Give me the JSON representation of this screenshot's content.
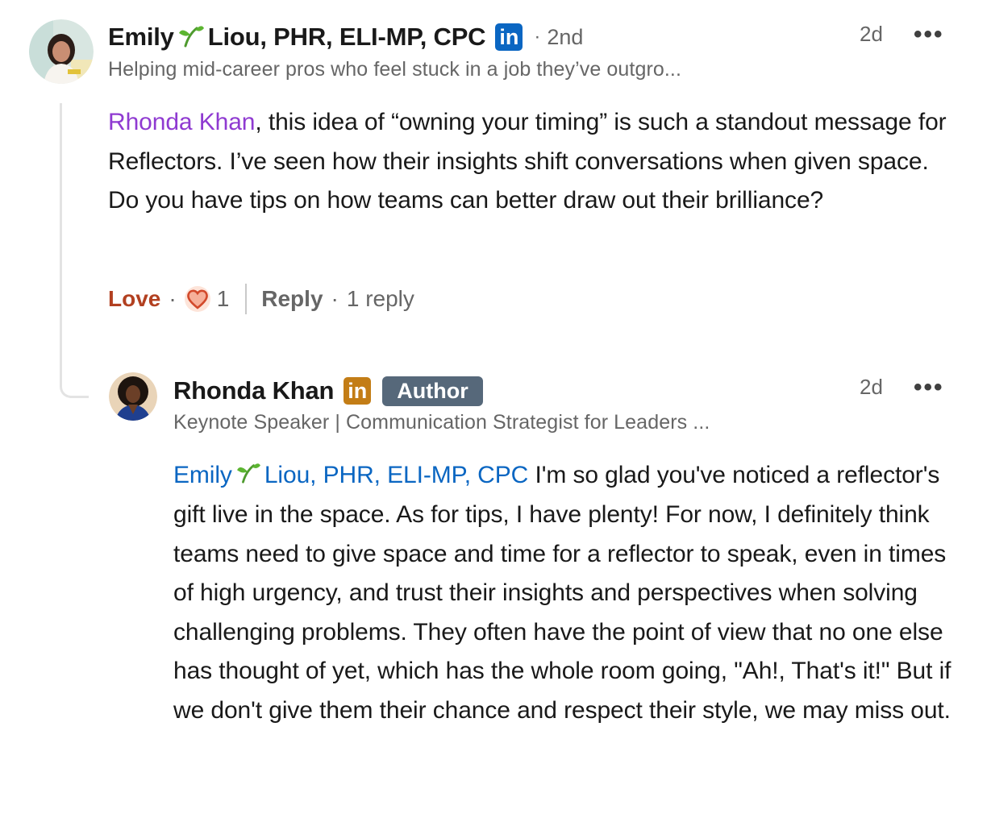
{
  "comment": {
    "author": {
      "first_name": "Emily",
      "emoji": "sprout",
      "rest_name": "Liou, PHR, ELI-MP, CPC",
      "linkedin_badge": "in",
      "degree_sep": "·",
      "degree": "2nd",
      "headline": "Helping mid-career pros who feel stuck in a job they’ve outgro..."
    },
    "time": "2d",
    "more": "•••",
    "mention": "Rhonda Khan",
    "text": ", this idea of “owning your timing” is such a standout message for Reflectors. I’ve seen how their insights shift conversations when given space. Do you have tips on how teams can better draw out their brilliance?",
    "actions": {
      "reaction_label": "Love",
      "sep": "·",
      "reaction_icon": "heart-icon",
      "reaction_count": "1",
      "reply_label": "Reply",
      "reply_sep": "·",
      "reply_count": "1 reply"
    }
  },
  "reply": {
    "author": {
      "name": "Rhonda Khan",
      "linkedin_badge": "in",
      "badge": "Author",
      "headline": "Keynote Speaker | Communication Strategist for Leaders ..."
    },
    "time": "2d",
    "more": "•••",
    "mention_first": "Emily",
    "mention_emoji": "sprout",
    "mention_rest": "Liou, PHR, ELI-MP, CPC",
    "text": " I'm so glad you've noticed a reflector's gift live in the space. As for tips, I have plenty! For now, I definitely think teams need to give space and time for a reflector to speak, even in times of high urgency, and trust their insights and perspectives when solving challenging problems. They often have the point of view that no one else has thought of yet, which has the whole room going, \"Ah!, That's it!\" But if we don't give them their chance and respect their style, we may miss out."
  },
  "colors": {
    "linkedin_blue": "#0a66c2",
    "linkedin_gold": "#c37d16",
    "mention_purple": "#8f3ad1",
    "love_red": "#b24020",
    "author_badge": "#56687a"
  }
}
